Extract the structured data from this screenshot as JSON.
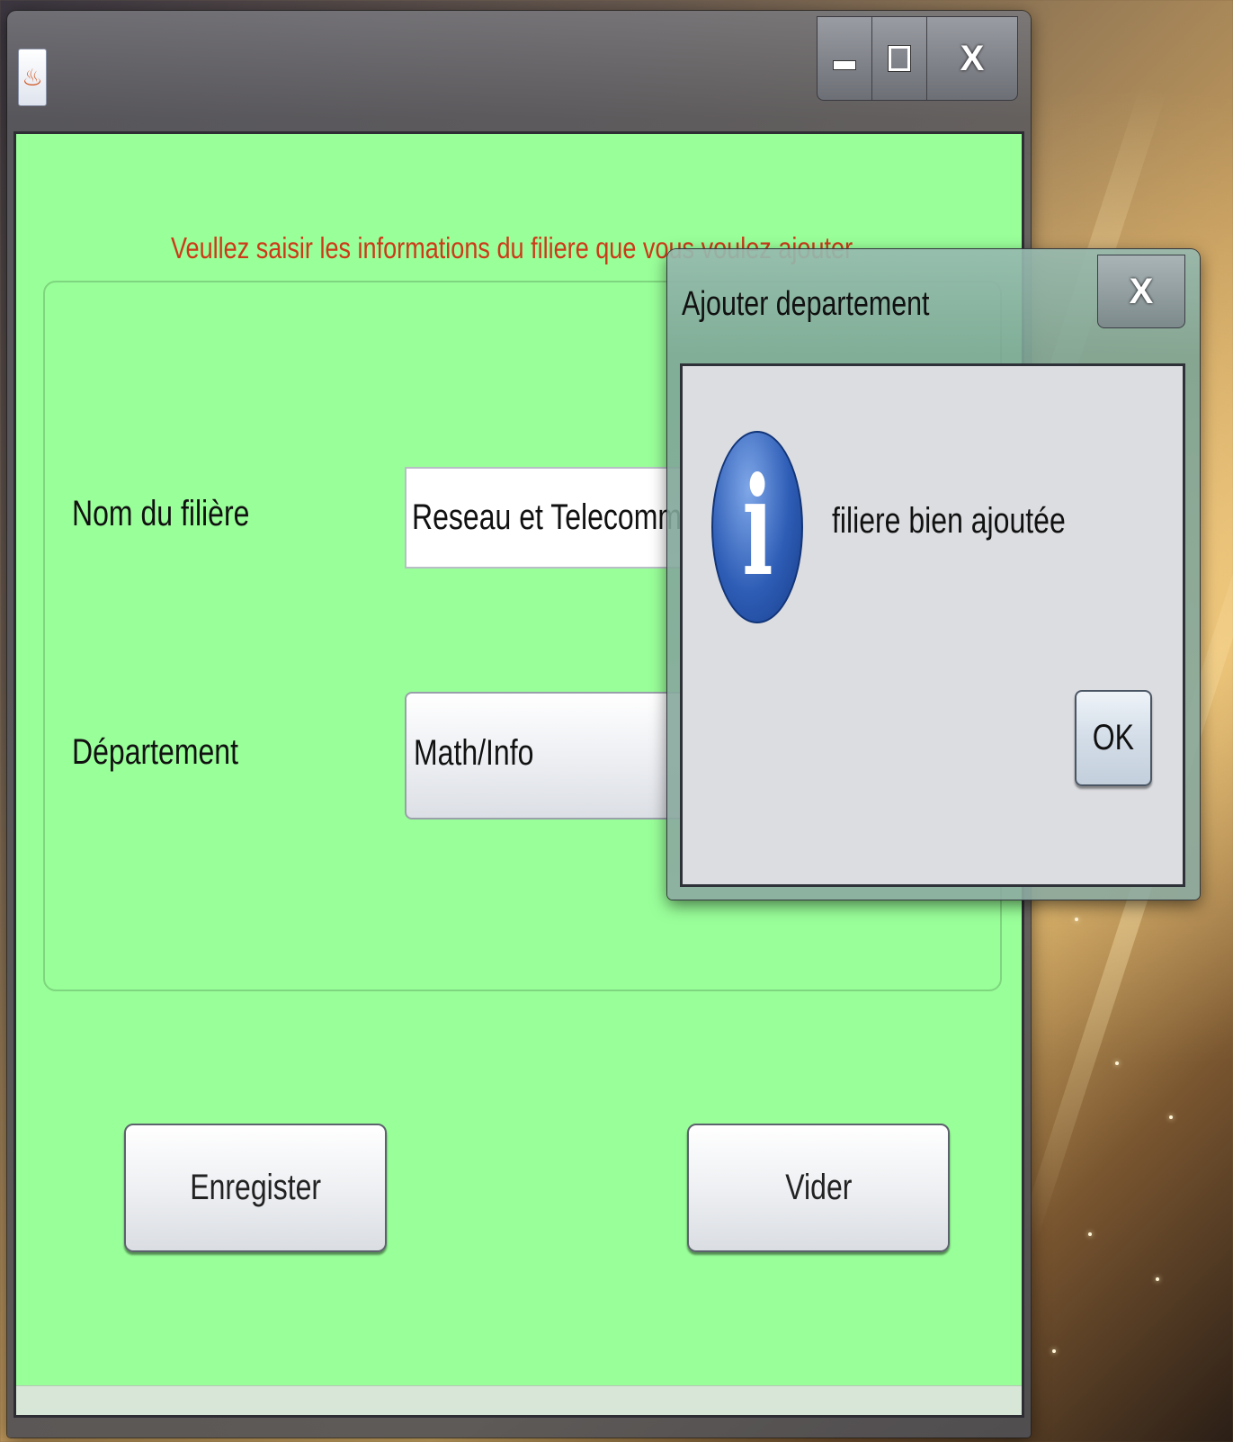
{
  "main_window": {
    "heading": "Veullez saisir les informations  du filiere que vous voulez ajouter",
    "fields": {
      "nom_label": "Nom du filière",
      "nom_value": "Reseau et Telecommunic",
      "departement_label": "Département",
      "departement_value": "Math/Info"
    },
    "buttons": {
      "save": "Enregister",
      "clear": "Vider"
    },
    "caption": {
      "close": "X"
    },
    "colors": {
      "background": "#99ff99",
      "heading": "#cc3a18"
    }
  },
  "dialog": {
    "title": "Ajouter departement",
    "message": "filiere bien ajoutée",
    "ok": "OK",
    "close": "X",
    "icon": "info-icon"
  }
}
